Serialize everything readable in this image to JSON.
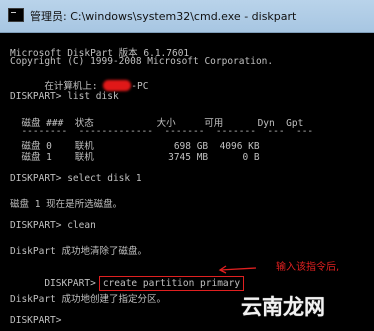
{
  "window": {
    "title": "管理员: C:\\windows\\system32\\cmd.exe - diskpart"
  },
  "console": {
    "lines": [
      "Microsoft DiskPart 版本 6.1.7601",
      "Copyright (C) 1999-2008 Microsoft Corporation.",
      "",
      "",
      "DISKPART> list disk",
      "  磁盘 ###  状态           大小     可用      Dyn  Gpt",
      "  --------  -------------  -------  -------  ---  ---",
      "  磁盘 0    联机              698 GB  4096 KB",
      "  磁盘 1    联机             3745 MB      0 B",
      "DISKPART> select disk 1",
      "磁盘 1 现在是所选磁盘。",
      "DISKPART> clean",
      "DiskPart 成功地清除了磁盘。",
      "",
      "DiskPart 成功地创建了指定分区。",
      "DISKPART>"
    ],
    "computer_label": "在计算机上: ",
    "computer_suffix": "-PC",
    "prompt": "DISKPART>",
    "highlighted_command": "create partition primary"
  },
  "annotation": {
    "text": "输入该指令后,",
    "color": "#e02020"
  },
  "watermark": {
    "text": "云南龙网"
  }
}
